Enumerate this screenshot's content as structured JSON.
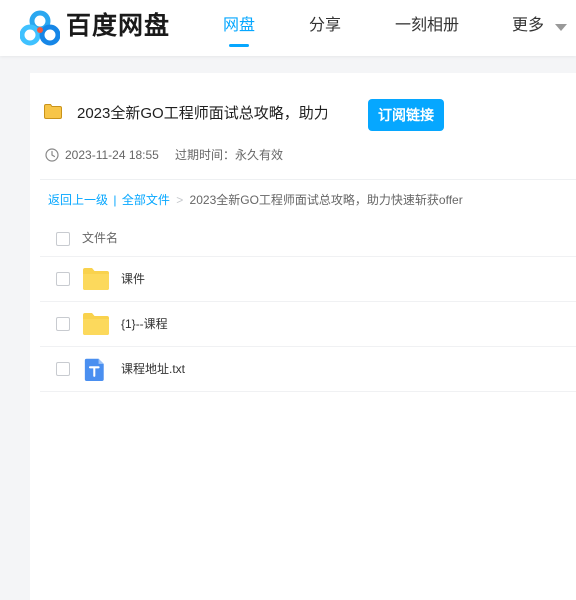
{
  "header": {
    "brand": "百度网盘",
    "nav": [
      "网盘",
      "分享",
      "一刻相册",
      "更多"
    ],
    "active_nav": "网盘",
    "accent_color": "#06a7ff"
  },
  "share": {
    "title": "2023全新GO工程师面试总攻略，助力...",
    "subscribe_label": "订阅链接",
    "date": "2023-11-24 18:55",
    "expire_label": "过期时间：永久有效"
  },
  "breadcrumb": {
    "back": "返回上一级",
    "sep1": "|",
    "all_files": "全部文件",
    "sep2": ">",
    "current": "2023全新GO工程师面试总攻略，助力快速斩获offer"
  },
  "file_list": {
    "column_header": "文件名",
    "rows": [
      {
        "name": "课件",
        "icon": "folder-icon"
      },
      {
        "name": "{1}--课程",
        "icon": "folder-icon"
      },
      {
        "name": "课程地址.txt",
        "icon": "txt-file-icon"
      }
    ]
  }
}
